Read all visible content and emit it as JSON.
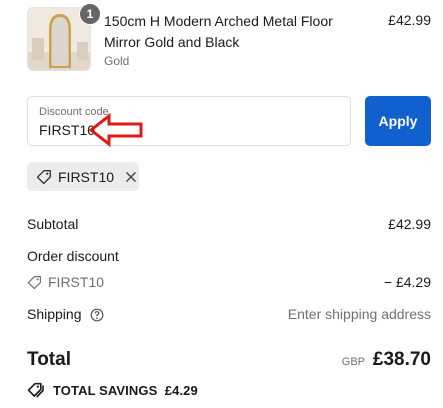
{
  "product": {
    "quantity": "1",
    "title": "150cm H Modern Arched Metal Floor Mirror Gold and Black",
    "variant": "Gold",
    "price": "£42.99"
  },
  "discount": {
    "label": "Discount code",
    "value": "FIRST10",
    "apply_label": "Apply",
    "applied_code": "FIRST10"
  },
  "summary": {
    "subtotal_label": "Subtotal",
    "subtotal_value": "£42.99",
    "order_discount_label": "Order discount",
    "discount_code": "FIRST10",
    "discount_value": "− £4.29",
    "shipping_label": "Shipping",
    "shipping_value": "Enter shipping address",
    "total_label": "Total",
    "currency": "GBP",
    "total_value": "£38.70",
    "savings_label": "TOTAL SAVINGS",
    "savings_value": "£4.29"
  },
  "colors": {
    "apply_button": "#1060d0",
    "annotation_arrow": "#e01818"
  },
  "icons": {
    "tag": "tag-icon",
    "close": "close-icon",
    "help": "help-circle-icon",
    "savings_tag": "tags-icon"
  }
}
